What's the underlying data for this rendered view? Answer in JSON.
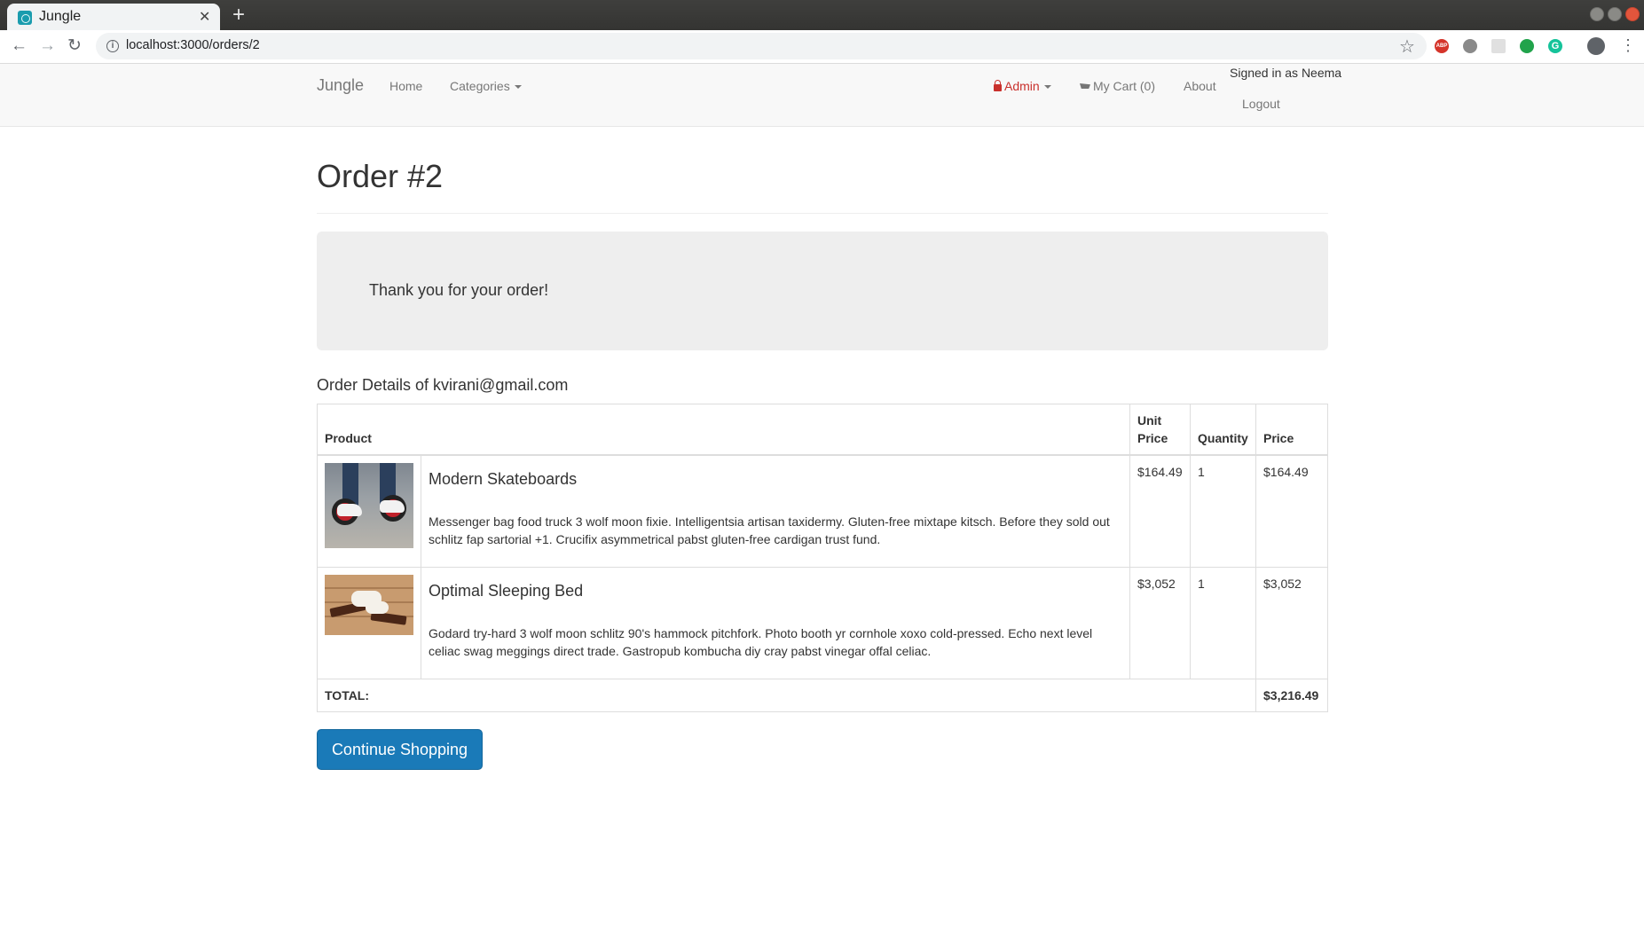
{
  "browser": {
    "tab_title": "Jungle",
    "tab_close": "✕",
    "new_tab": "+",
    "url": "localhost:3000/orders/2",
    "back": "←",
    "forward": "→",
    "reload": "↻",
    "star": "☆",
    "menu": "⋮",
    "info": "i",
    "ext_abp": "ABP",
    "ext_g": "G"
  },
  "nav": {
    "brand": "Jungle",
    "home": "Home",
    "categories": "Categories",
    "admin": "Admin",
    "cart": "My Cart (0)",
    "about": "About",
    "signed_in": "Signed in as Neema",
    "logout": "Logout"
  },
  "page": {
    "title": "Order #2",
    "thanks": "Thank you for your order!",
    "details_heading": "Order Details of kvirani@gmail.com",
    "continue_button": "Continue Shopping"
  },
  "table": {
    "headers": {
      "product": "Product",
      "unit_price": "Unit Price",
      "quantity": "Quantity",
      "price": "Price"
    },
    "items": [
      {
        "name": "Modern Skateboards",
        "description": "Messenger bag food truck 3 wolf moon fixie. Intelligentsia artisan taxidermy. Gluten-free mixtape kitsch. Before they sold out schlitz fap sartorial +1. Crucifix asymmetrical pabst gluten-free cardigan trust fund.",
        "unit_price": "$164.49",
        "quantity": "1",
        "price": "$164.49"
      },
      {
        "name": "Optimal Sleeping Bed",
        "description": "Godard try-hard 3 wolf moon schlitz 90's hammock pitchfork. Photo booth yr cornhole xoxo cold-pressed. Echo next level celiac swag meggings direct trade. Gastropub kombucha diy cray pabst vinegar offal celiac.",
        "unit_price": "$3,052",
        "quantity": "1",
        "price": "$3,052"
      }
    ],
    "total_label": "TOTAL:",
    "total_value": "$3,216.49"
  },
  "colors": {
    "primary_button": "#1a7ab8",
    "admin_link": "#c9302c",
    "jumbotron_bg": "#eeeeee",
    "navbar_bg": "#f8f8f8"
  }
}
